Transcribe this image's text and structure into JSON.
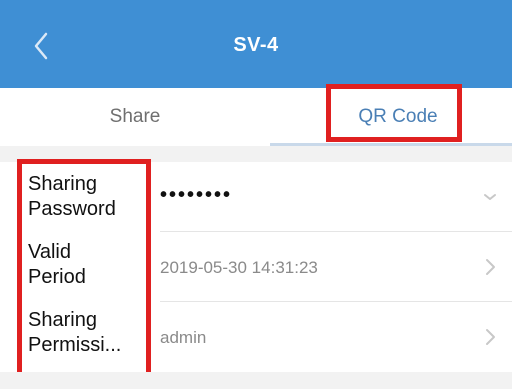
{
  "header": {
    "title": "SV-4",
    "back_icon": "chevron-left-icon",
    "background": "#3f8fd4"
  },
  "tabs": [
    {
      "label": "Share",
      "active": false
    },
    {
      "label": "QR Code",
      "active": true
    }
  ],
  "rows": [
    {
      "label_line1": "Sharing",
      "label_line2": "Password",
      "value": "••••••••",
      "icon": "chevron-down-icon"
    },
    {
      "label_line1": "Valid",
      "label_line2": "Period",
      "value": "2019-05-30 14:31:23",
      "icon": "chevron-right-icon"
    },
    {
      "label_line1": "Sharing",
      "label_line2": "Permissi...",
      "value": "admin",
      "icon": "chevron-right-icon"
    }
  ],
  "highlight_color": "#e02020"
}
